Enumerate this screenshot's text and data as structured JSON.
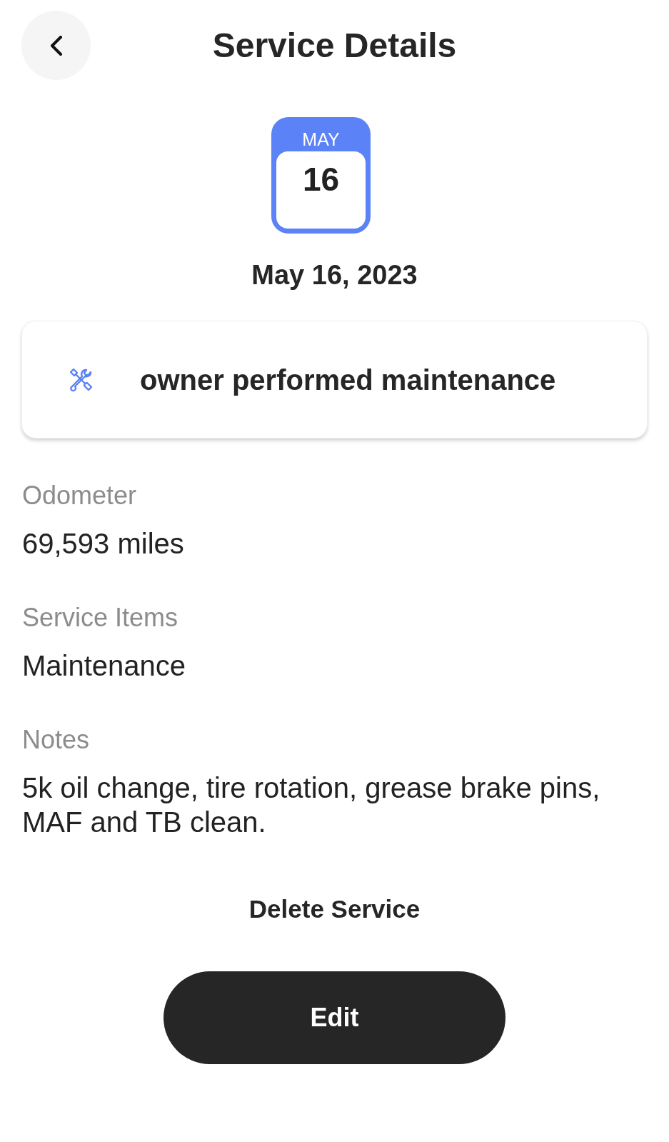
{
  "header": {
    "title": "Service Details"
  },
  "calendar": {
    "month": "MAY",
    "day": "16"
  },
  "date": "May 16, 2023",
  "service_type": {
    "label": "owner performed maintenance"
  },
  "details": [
    {
      "label": "Odometer",
      "value": "69,593 miles"
    },
    {
      "label": "Service Items",
      "value": "Maintenance"
    },
    {
      "label": "Notes",
      "value": "5k oil change, tire rotation, grease brake pins, MAF and TB clean."
    }
  ],
  "actions": {
    "delete": "Delete Service",
    "edit": "Edit"
  }
}
